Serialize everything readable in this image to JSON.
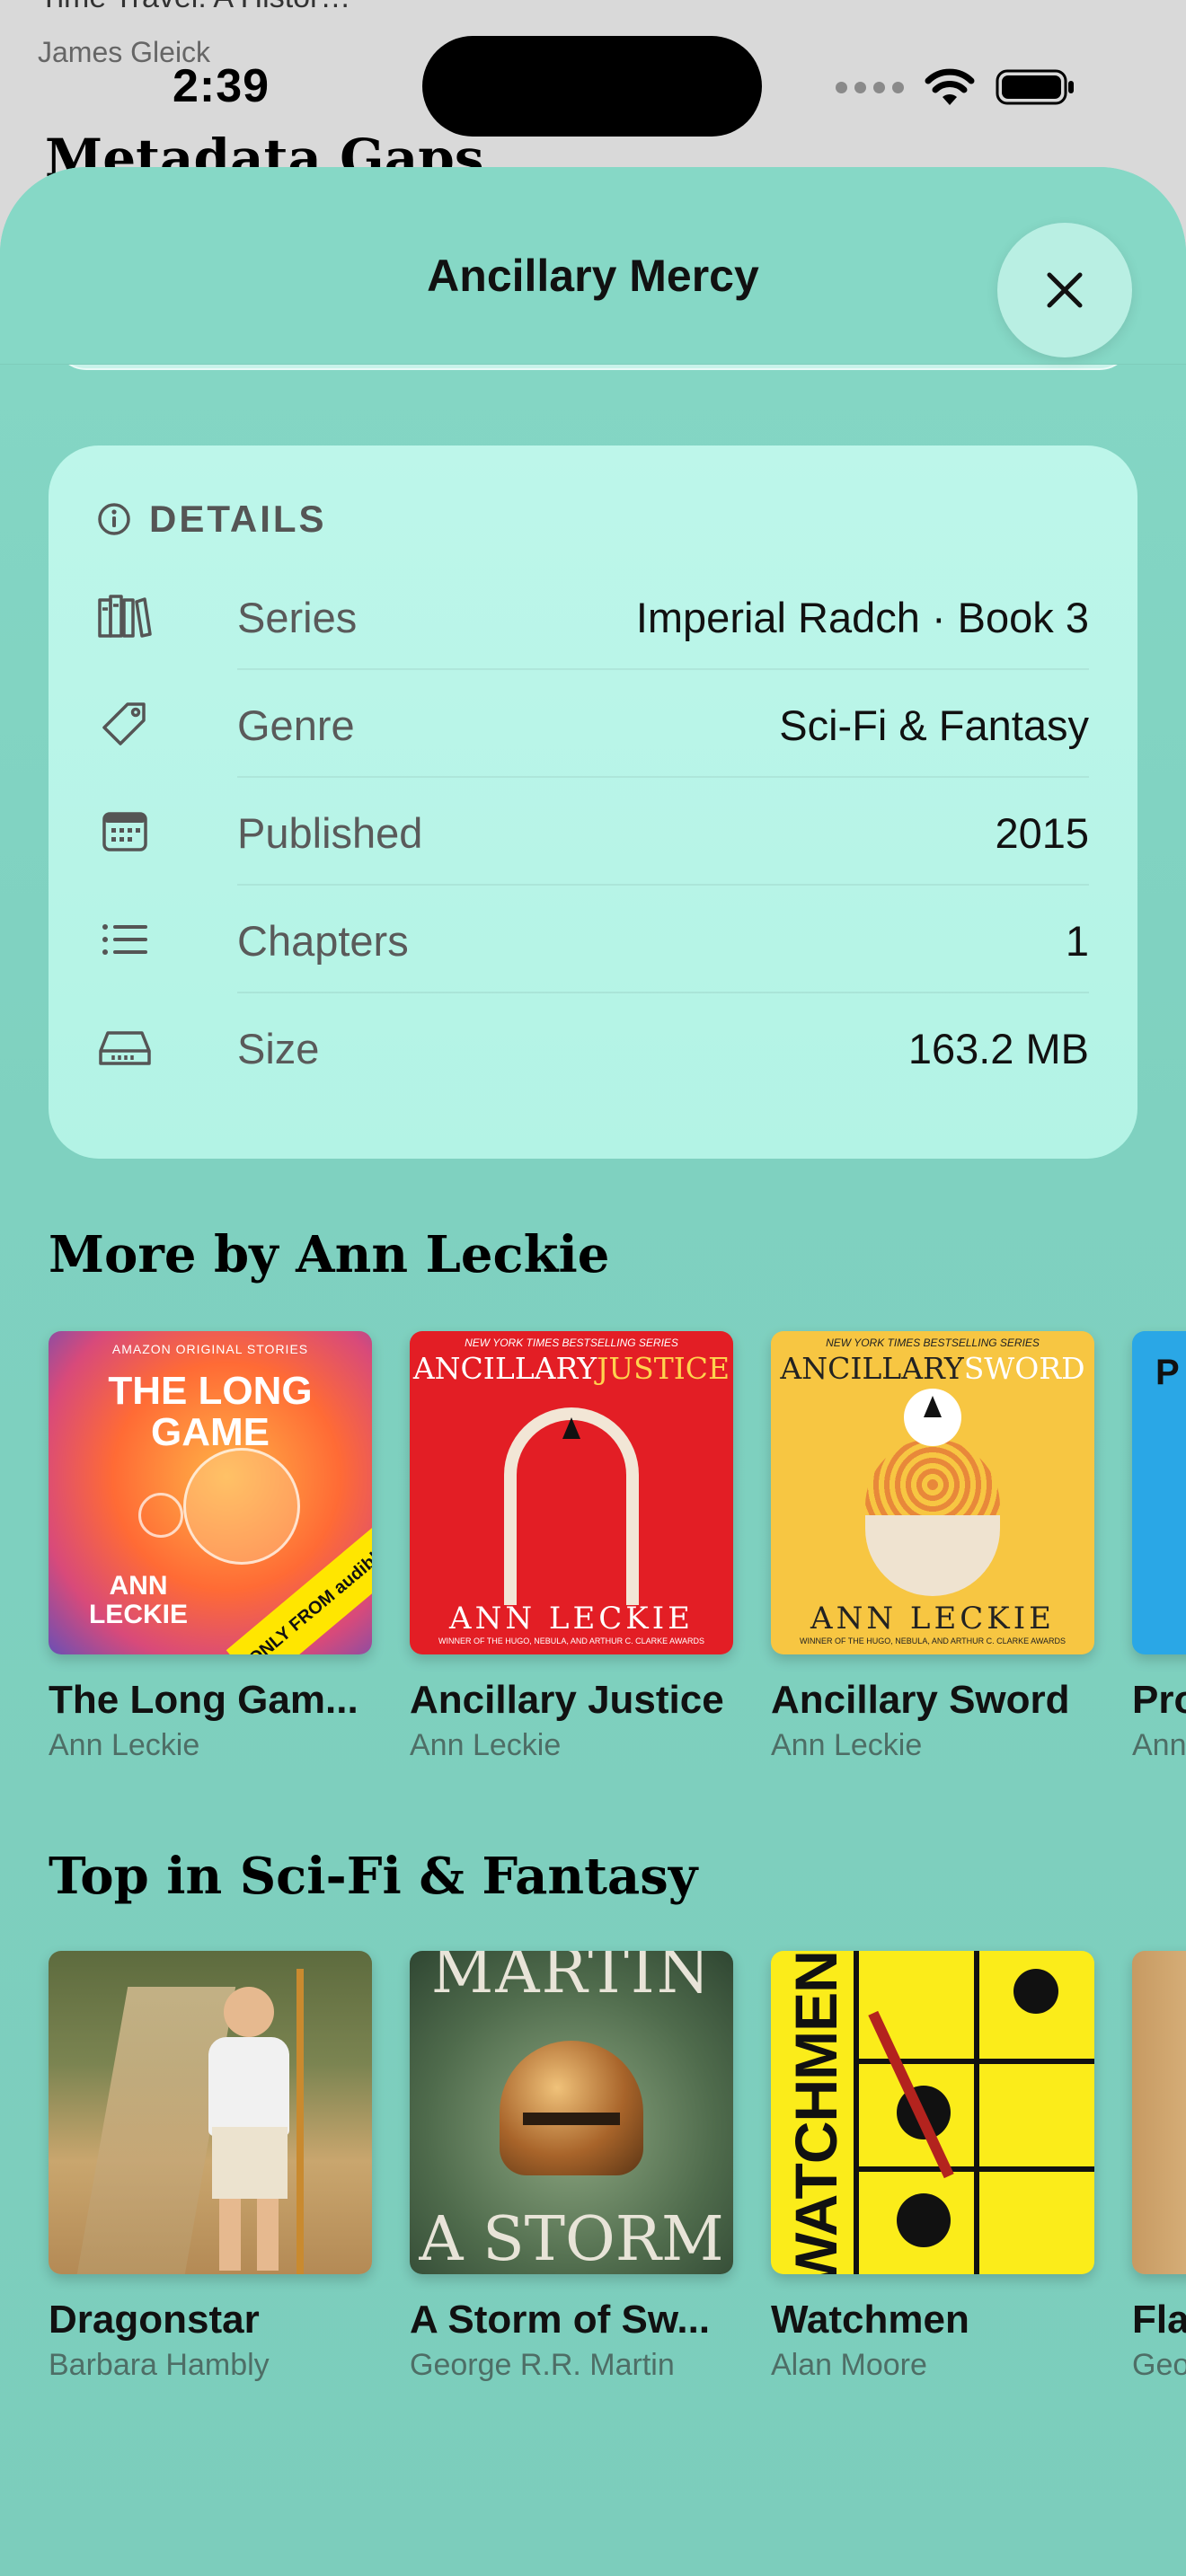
{
  "background": {
    "top_title": "Time Travel: A Histor…",
    "author": "James Gleick",
    "heading": "Metadata Gaps"
  },
  "status_bar": {
    "time": "2:39"
  },
  "sheet": {
    "title": "Ancillary Mercy"
  },
  "details": {
    "header": "DETAILS",
    "rows": [
      {
        "icon": "books-icon",
        "label": "Series",
        "value": "Imperial Radch · Book 3"
      },
      {
        "icon": "tag-icon",
        "label": "Genre",
        "value": "Sci-Fi & Fantasy"
      },
      {
        "icon": "calendar-icon",
        "label": "Published",
        "value": "2015"
      },
      {
        "icon": "list-icon",
        "label": "Chapters",
        "value": "1"
      },
      {
        "icon": "drive-icon",
        "label": "Size",
        "value": "163.2 MB"
      }
    ]
  },
  "more_by": {
    "title": "More by Ann Leckie",
    "books": [
      {
        "title": "The Long Gam...",
        "author": "Ann Leckie",
        "cover_banner": "AMAZON ORIGINAL STORIES",
        "cover_title": "THE LONG GAME",
        "cover_author": "ANN LECKIE",
        "cover_tag": "ONLY FROM audible"
      },
      {
        "title": "Ancillary Justice",
        "author": "Ann Leckie",
        "cover_banner": "NEW YORK TIMES BESTSELLING SERIES",
        "cover_title_a": "ANCILLARY",
        "cover_title_b": "JUSTICE",
        "cover_author": "ANN LECKIE",
        "cover_footer": "WINNER OF THE HUGO, NEBULA, AND ARTHUR C. CLARKE AWARDS"
      },
      {
        "title": "Ancillary Sword",
        "author": "Ann Leckie",
        "cover_banner": "NEW YORK TIMES BESTSELLING SERIES",
        "cover_title_a": "ANCILLARY",
        "cover_title_b": "SWORD",
        "cover_author": "ANN LECKIE",
        "cover_footer": "WINNER OF THE HUGO, NEBULA, AND ARTHUR C. CLARKE AWARDS"
      },
      {
        "title": "Pro",
        "author": "Ann",
        "cover_letter": "P"
      }
    ]
  },
  "top_in": {
    "title": "Top in Sci-Fi & Fantasy",
    "books": [
      {
        "title": "Dragonstar",
        "author": "Barbara Hambly"
      },
      {
        "title": "A Storm of Sw...",
        "author": "George R.R. Martin",
        "cover_top": "MARTIN",
        "cover_bottom": "A STORM"
      },
      {
        "title": "Watchmen",
        "author": "Alan Moore",
        "cover_text": "WATCHMEN"
      },
      {
        "title": "Fla",
        "author": "Geo"
      }
    ]
  },
  "colors": {
    "sheet": "#85d7c5",
    "card": "#bdf6ea",
    "justice_cover": "#e31e25",
    "sword_cover": "#f7c642"
  }
}
